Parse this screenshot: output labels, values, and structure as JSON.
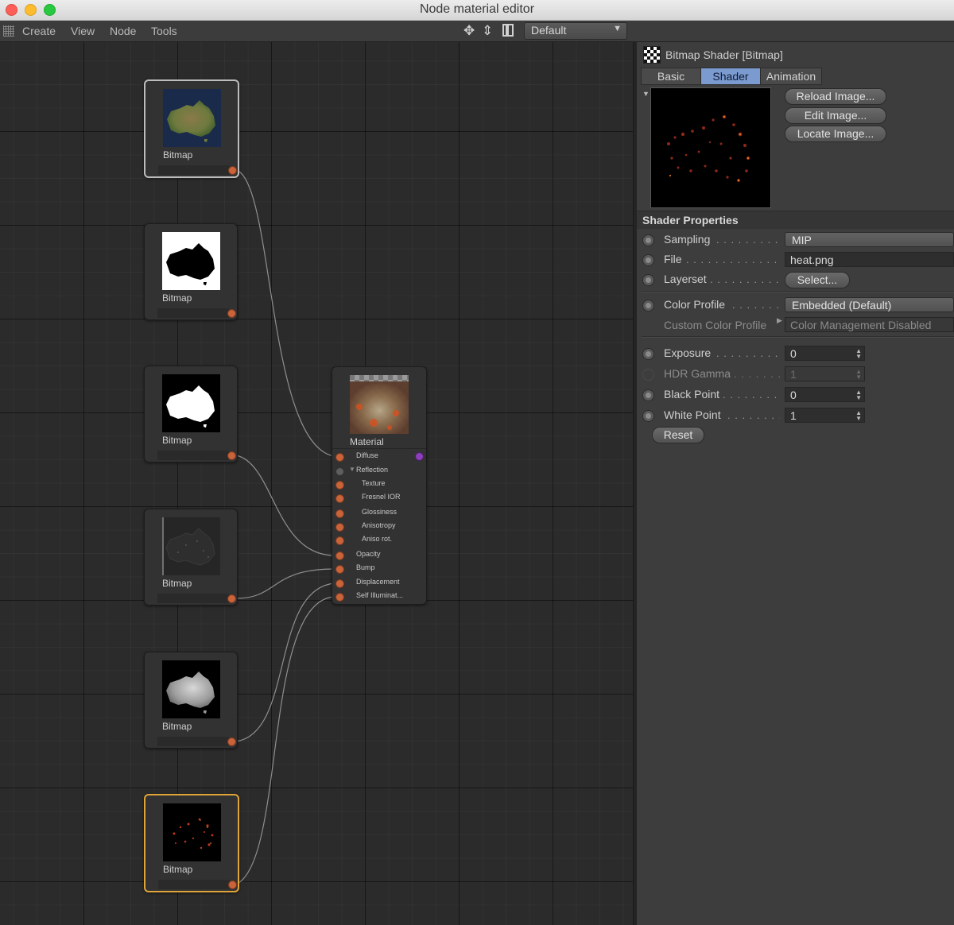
{
  "window": {
    "title": "Node material editor"
  },
  "menubar": {
    "items": [
      "Create",
      "View",
      "Node",
      "Tools"
    ],
    "layout_select": "Default",
    "icons": [
      "move-icon",
      "vertical-move-icon",
      "panel-layout-icon"
    ]
  },
  "colors": {
    "accent_tab": "#7b9bd0",
    "port_orange": "#c8633a",
    "port_purple": "#8b3fb8",
    "selected_node": "#e0a53a"
  },
  "canvas": {
    "bitmap_nodes": [
      {
        "label": "Bitmap",
        "thumb": "australia-satellite"
      },
      {
        "label": "Bitmap",
        "thumb": "australia-black-mask"
      },
      {
        "label": "Bitmap",
        "thumb": "australia-white-mask"
      },
      {
        "label": "Bitmap",
        "thumb": "australia-dark-noise"
      },
      {
        "label": "Bitmap",
        "thumb": "australia-gray-height"
      },
      {
        "label": "Bitmap",
        "thumb": "australia-heat"
      }
    ],
    "material_node": {
      "label": "Material",
      "ports": [
        "Diffuse",
        "Reflection",
        "Texture",
        "Fresnel IOR",
        "Glossiness",
        "Anisotropy",
        "Aniso rot.",
        "Opacity",
        "Bump",
        "Displacement",
        "Self Illuminat..."
      ]
    }
  },
  "panel": {
    "header": "Bitmap Shader [Bitmap]",
    "tabs": [
      "Basic",
      "Shader",
      "Animation"
    ],
    "active_tab": "Shader",
    "buttons": {
      "reload": "Reload Image...",
      "edit": "Edit Image...",
      "locate": "Locate Image...",
      "select": "Select...",
      "reset": "Reset"
    },
    "section_title": "Shader Properties",
    "sampling": {
      "label": "Sampling",
      "value": "MIP"
    },
    "file": {
      "label": "File",
      "value": "heat.png"
    },
    "layerset": {
      "label": "Layerset"
    },
    "color_profile": {
      "label": "Color Profile",
      "value": "Embedded (Default)"
    },
    "custom_color_profile": {
      "label": "Custom Color Profile",
      "value": "Color Management Disabled"
    },
    "exposure": {
      "label": "Exposure",
      "value": "0"
    },
    "hdr_gamma": {
      "label": "HDR Gamma",
      "value": "1"
    },
    "black_point": {
      "label": "Black Point",
      "value": "0"
    },
    "white_point": {
      "label": "White Point",
      "value": "1"
    }
  }
}
